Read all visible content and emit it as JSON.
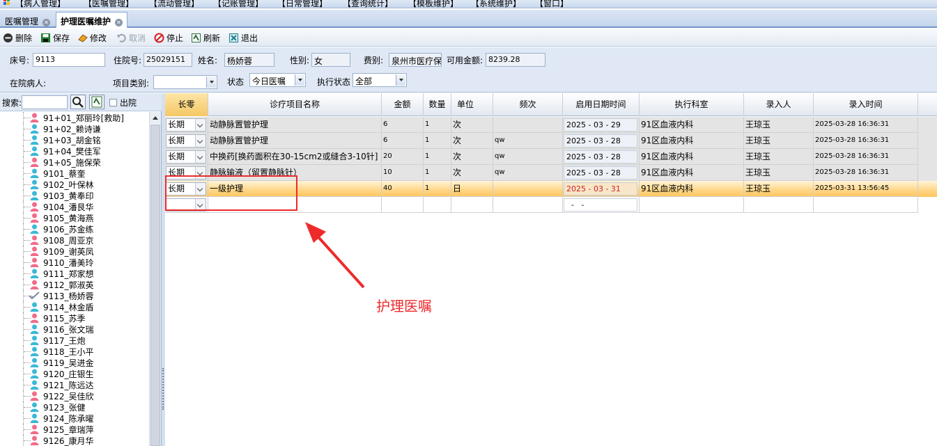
{
  "menu": {
    "items": [
      "【病人管理】",
      "【医嘱管理】",
      "【流动管理】",
      "【记账管理】",
      "【日常管理】",
      "【查询统计】",
      "【模板维护】",
      "【系统维护】",
      "【窗口】"
    ]
  },
  "tabs": [
    {
      "label": "医嘱管理",
      "active": false
    },
    {
      "label": "护理医嘱维护",
      "active": true
    }
  ],
  "toolbar": {
    "delete_label": "删除",
    "save_label": "保存",
    "edit_label": "修改",
    "cancel_label": "取消",
    "stop_label": "停止",
    "refresh_label": "刷新",
    "exit_label": "退出"
  },
  "patient": {
    "bed_label": "床号:",
    "bed_value": "9113",
    "admission_label": "住院号:",
    "admission_value": "25029151",
    "name_label": "姓名:",
    "name_value": "杨娇蓉",
    "gender_label": "性别:",
    "gender_value": "女",
    "fee_type_label": "费别:",
    "fee_type_value": "泉州市医疗保",
    "balance_label": "可用金额:",
    "balance_value": "8239.28",
    "inpatient_label": "在院病人:",
    "item_type_label": "项目类别:",
    "item_type_value": "",
    "status_label": "状态",
    "status_value": "今日医嘱",
    "exec_status_label": "执行状态",
    "exec_status_value": "全部"
  },
  "search": {
    "label": "搜索:",
    "value": "",
    "discharged_label": "出院"
  },
  "patients": [
    {
      "text": "91+01_郑丽玲[救助]",
      "gender": "f"
    },
    {
      "text": "91+02_赖诗谦",
      "gender": "m"
    },
    {
      "text": "91+03_胡金铭",
      "gender": "m"
    },
    {
      "text": "91+04_樊佳军",
      "gender": "m"
    },
    {
      "text": "91+05_施保荣",
      "gender": "f"
    },
    {
      "text": "9101_蔡奎",
      "gender": "m"
    },
    {
      "text": "9102_叶保林",
      "gender": "m"
    },
    {
      "text": "9103_黄奉印",
      "gender": "m"
    },
    {
      "text": "9104_潘艮华",
      "gender": "f"
    },
    {
      "text": "9105_黄海燕",
      "gender": "f"
    },
    {
      "text": "9106_苏金练",
      "gender": "m"
    },
    {
      "text": "9108_周亚京",
      "gender": "f"
    },
    {
      "text": "9109_谢英凤",
      "gender": "f"
    },
    {
      "text": "9110_潘美玲",
      "gender": "f"
    },
    {
      "text": "9111_郑家想",
      "gender": "m"
    },
    {
      "text": "9112_郭淑英",
      "gender": "f"
    },
    {
      "text": "9113_杨娇蓉",
      "gender": "check"
    },
    {
      "text": "9114_林金盾",
      "gender": "m"
    },
    {
      "text": "9115_苏季",
      "gender": "f"
    },
    {
      "text": "9116_张文瑞",
      "gender": "m"
    },
    {
      "text": "9117_王炮",
      "gender": "m"
    },
    {
      "text": "9118_王小平",
      "gender": "m"
    },
    {
      "text": "9119_吴进金",
      "gender": "m"
    },
    {
      "text": "9120_庄银生",
      "gender": "m"
    },
    {
      "text": "9121_陈远达",
      "gender": "m"
    },
    {
      "text": "9122_吴佳欣",
      "gender": "f"
    },
    {
      "text": "9123_张健",
      "gender": "m"
    },
    {
      "text": "9124_陈承曜",
      "gender": "m"
    },
    {
      "text": "9125_章瑞萍",
      "gender": "f"
    },
    {
      "text": "9126_康月华",
      "gender": "f"
    }
  ],
  "grid": {
    "columns": [
      "长零",
      "诊疗项目名称",
      "金额",
      "数量",
      "单位",
      "频次",
      "启用日期时间",
      "执行科室",
      "录入人",
      "录入时间"
    ],
    "rows": [
      {
        "type": "长期",
        "name": "动静脉置管护理",
        "amount": "6",
        "qty": "1",
        "unit": "次",
        "freq": "",
        "start": "2025 - 03 - 29",
        "dept": "91区血液内科",
        "entered_by": "王琼玉",
        "entered_at": "2025-03-28 16:36:31",
        "style": "gray"
      },
      {
        "type": "长期",
        "name": "动静脉置管护理",
        "amount": "6",
        "qty": "1",
        "unit": "次",
        "freq": "qw",
        "start": "2025 - 03 - 28",
        "dept": "91区血液内科",
        "entered_by": "王琼玉",
        "entered_at": "2025-03-28 16:36:31",
        "style": "gray"
      },
      {
        "type": "长期",
        "name": "中换药[换药面积在30-15cm2或缝合3-10针]",
        "amount": "20",
        "qty": "1",
        "unit": "次",
        "freq": "qw",
        "start": "2025 - 03 - 28",
        "dept": "91区血液内科",
        "entered_by": "王琼玉",
        "entered_at": "2025-03-28 16:36:31",
        "style": "gray"
      },
      {
        "type": "长期",
        "name": "静脉输液（留置静脉针）",
        "amount": "10",
        "qty": "1",
        "unit": "次",
        "freq": "qw",
        "start": "2025 - 03 - 28",
        "dept": "91区血液内科",
        "entered_by": "王琼玉",
        "entered_at": "2025-03-28 16:36:31",
        "style": "gray"
      },
      {
        "type": "长期",
        "name": "一级护理",
        "amount": "40",
        "qty": "1",
        "unit": "日",
        "freq": "",
        "start": "2025 - 03 - 31",
        "dept": "91区血液内科",
        "entered_by": "王琼玉",
        "entered_at": "2025-03-31 13:56:45",
        "style": "sel"
      },
      {
        "type": "",
        "name": "",
        "amount": "",
        "qty": "",
        "unit": "",
        "freq": "",
        "start": "  -   -",
        "dept": "",
        "entered_by": "",
        "entered_at": "",
        "style": "empty"
      }
    ]
  },
  "annotation": {
    "label": "护理医嘱",
    "color": "#ee2a2a"
  }
}
